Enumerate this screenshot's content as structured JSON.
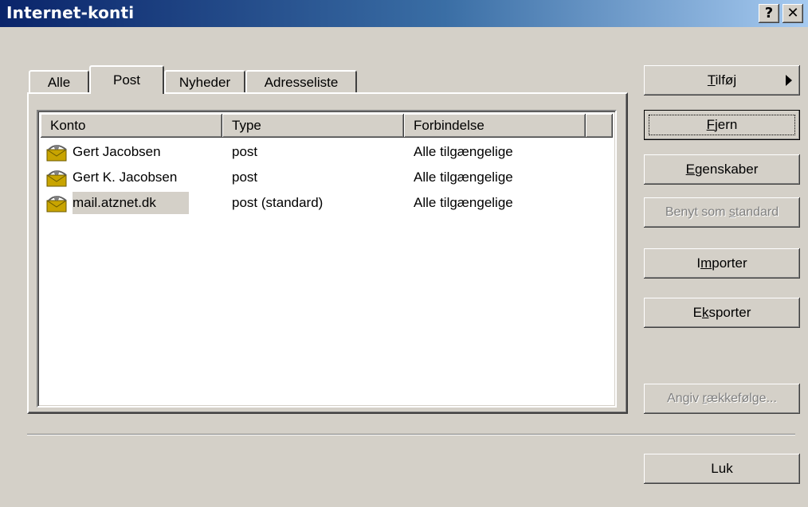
{
  "window": {
    "title": "Internet-konti",
    "help_glyph": "?",
    "close_glyph": "✕"
  },
  "tabs": [
    {
      "label": "Alle"
    },
    {
      "label": "Post"
    },
    {
      "label": "Nyheder"
    },
    {
      "label": "Adresseliste"
    }
  ],
  "active_tab": "Post",
  "list": {
    "columns": [
      "Konto",
      "Type",
      "Forbindelse"
    ],
    "rows": [
      {
        "account": "Gert Jacobsen",
        "type": "post",
        "connection": "Alle tilgængelige",
        "icon": "mail-account-icon"
      },
      {
        "account": "Gert K. Jacobsen",
        "type": "post",
        "connection": "Alle tilgængelige",
        "icon": "mail-account-icon"
      },
      {
        "account": "mail.atznet.dk",
        "type": "post (standard)",
        "connection": "Alle tilgængelige",
        "icon": "mail-account-icon",
        "selected": true
      }
    ]
  },
  "buttons": {
    "add": {
      "pre": "",
      "key": "T",
      "post": "ilføj"
    },
    "remove": {
      "pre": "",
      "key": "F",
      "post": "jern"
    },
    "properties": {
      "pre": "",
      "key": "E",
      "post": "genskaber"
    },
    "set_default": {
      "pre": "Benyt som ",
      "key": "s",
      "post": "tandard"
    },
    "import": {
      "pre": "I",
      "key": "m",
      "post": "porter"
    },
    "export": {
      "pre": "E",
      "key": "k",
      "post": "sporter"
    },
    "set_order": {
      "pre": "Angiv ",
      "key": "r",
      "post": "ækkefølge..."
    },
    "close": "Luk"
  },
  "colors": {
    "face": "#d4d0c8",
    "title_start": "#0a246a",
    "title_end": "#a6caf0"
  }
}
